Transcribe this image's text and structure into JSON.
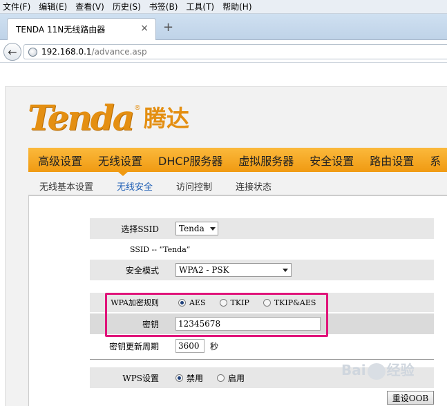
{
  "browser": {
    "menu": [
      "文件(F)",
      "编辑(E)",
      "查看(V)",
      "历史(S)",
      "书签(B)",
      "工具(T)",
      "帮助(H)"
    ],
    "tab_title": "TENDA 11N无线路由器",
    "tab_close": "×",
    "new_tab": "+",
    "back": "←",
    "url_host": "192.168.0.1",
    "url_path": "/advance.asp"
  },
  "logo": {
    "text": "Tenda",
    "tm": "®",
    "cn": "腾达"
  },
  "main_nav": [
    "高级设置",
    "无线设置",
    "DHCP服务器",
    "虚拟服务器",
    "安全设置",
    "路由设置",
    "系"
  ],
  "main_nav_active": "无线设置",
  "sub_nav": [
    "无线基本设置",
    "无线安全",
    "访问控制",
    "连接状态"
  ],
  "sub_nav_active": "无线安全",
  "form": {
    "ssid_label": "选择SSID",
    "ssid_value": "Tenda",
    "ssid_info": "SSID -- “Tenda”",
    "mode_label": "安全模式",
    "mode_value": "WPA2 - PSK",
    "wpa_label": "WPA加密规则",
    "wpa_options": [
      "AES",
      "TKIP",
      "TKIP&AES"
    ],
    "wpa_selected": "AES",
    "key_label": "密钥",
    "key_value": "12345678",
    "renew_label": "密钥更新周期",
    "renew_value": "3600",
    "renew_unit": "秒",
    "wps_label": "WPS设置",
    "wps_options": [
      "禁用",
      "启用"
    ],
    "wps_selected": "禁用",
    "reset_label": "重设OOB"
  },
  "watermark": {
    "left": "Bai",
    "right": "经验"
  },
  "colors": {
    "accent": "#f09a12",
    "highlight": "#e0147a",
    "active_sub": "#1f5fb5"
  }
}
